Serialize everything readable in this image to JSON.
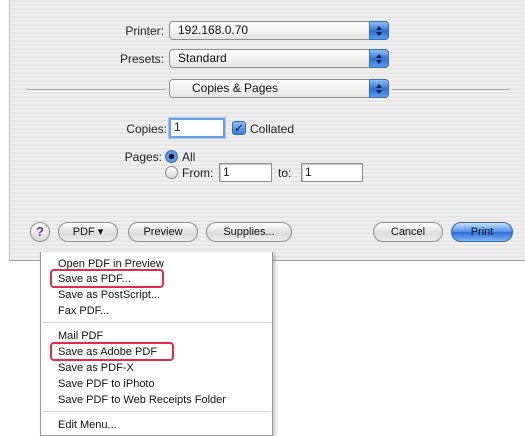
{
  "print_dialog": {
    "printer": {
      "label": "Printer:",
      "value": "192.168.0.70"
    },
    "presets": {
      "label": "Presets:",
      "value": "Standard"
    },
    "panel": {
      "value": "Copies & Pages"
    },
    "copies": {
      "label": "Copies:",
      "value": "1",
      "collated_label": "Collated",
      "collated": true
    },
    "pages": {
      "label": "Pages:",
      "all_label": "All",
      "from_label": "From:",
      "from_value": "1",
      "to_label": "to:",
      "to_value": "1"
    },
    "buttons": {
      "help": "?",
      "pdf": "PDF ▾",
      "preview": "Preview",
      "supplies": "Supplies...",
      "cancel": "Cancel",
      "print": "Print"
    }
  },
  "pdf_menu": {
    "group1": [
      "Open PDF in Preview",
      "Save as PDF...",
      "Save as PostScript...",
      "Fax PDF..."
    ],
    "group2": [
      "Mail PDF",
      "Save as Adobe PDF",
      "Save as PDF-X",
      "Save PDF to iPhoto",
      "Save PDF to Web Receipts Folder"
    ],
    "group3": [
      "Edit Menu..."
    ]
  },
  "colors": {
    "highlight": "#e32a4b",
    "accent": "#2e6fd4",
    "dialog_bg": "#ececec"
  }
}
